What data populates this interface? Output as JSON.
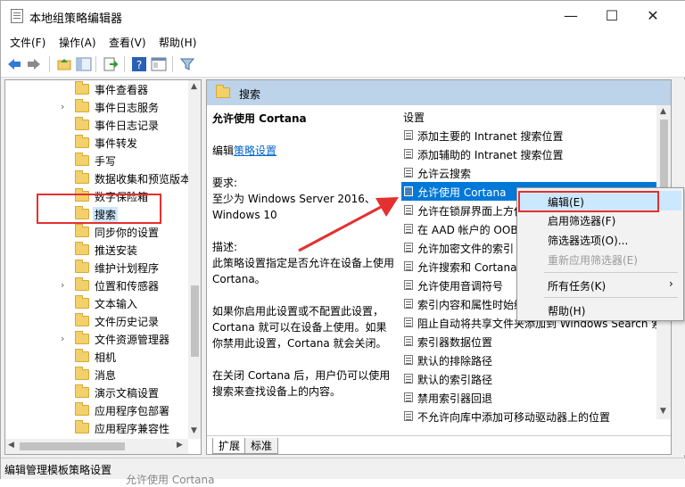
{
  "window": {
    "title": "本地组策略编辑器",
    "controls": {
      "minimize": "—",
      "maximize": "☐",
      "close": "✕"
    }
  },
  "menubar": [
    {
      "label": "文件(F)"
    },
    {
      "label": "操作(A)"
    },
    {
      "label": "查看(V)"
    },
    {
      "label": "帮助(H)"
    }
  ],
  "tree": {
    "items": [
      {
        "label": "事件查看器",
        "chevron": ""
      },
      {
        "label": "事件日志服务",
        "chevron": "›"
      },
      {
        "label": "事件日志记录",
        "chevron": ""
      },
      {
        "label": "事件转发",
        "chevron": ""
      },
      {
        "label": "手写",
        "chevron": ""
      },
      {
        "label": "数据收集和预览版本",
        "chevron": ""
      },
      {
        "label": "数字保险箱",
        "chevron": ""
      },
      {
        "label": "搜索",
        "chevron": ""
      },
      {
        "label": "同步你的设置",
        "chevron": ""
      },
      {
        "label": "推送安装",
        "chevron": ""
      },
      {
        "label": "维护计划程序",
        "chevron": ""
      },
      {
        "label": "位置和传感器",
        "chevron": "›"
      },
      {
        "label": "文本输入",
        "chevron": ""
      },
      {
        "label": "文件历史记录",
        "chevron": ""
      },
      {
        "label": "文件资源管理器",
        "chevron": "›"
      },
      {
        "label": "相机",
        "chevron": ""
      },
      {
        "label": "消息",
        "chevron": ""
      },
      {
        "label": "演示文稿设置",
        "chevron": ""
      },
      {
        "label": "应用程序包部署",
        "chevron": ""
      },
      {
        "label": "应用程序兼容性",
        "chevron": ""
      }
    ]
  },
  "right": {
    "header": "搜索",
    "description": {
      "title": "允许使用 Cortana",
      "edit_prefix": "编辑",
      "edit_link": "策略设置",
      "req_label": "要求:",
      "req_text": "至少为 Windows Server 2016、Windows 10",
      "desc_label": "描述:",
      "desc_text": "此策略设置指定是否允许在设备上使用 Cortana。",
      "p1": "如果你启用此设置或不配置此设置，Cortana 就可以在设备上使用。如果你禁用此设置，Cortana 就会关闭。",
      "p2": "在关闭 Cortana 后，用户仍可以使用搜索来查找设备上的内容。"
    },
    "list_header": "设置",
    "settings": [
      "添加主要的 Intranet 搜索位置",
      "添加辅助的 Intranet 搜索位置",
      "允许云搜索",
      "允许使用 Cortana",
      "允许在锁屏界面上方使用 Cortana",
      "在 AAD 帐户的 OOBE 期间允许 Cortana",
      "允许加密文件的索引",
      "允许搜索和 Cortana 使用位置",
      "允许使用音调符号",
      "索引内容和属性时始终使用自动语言检测",
      "阻止自动将共享文件夹添加到 Windows Search 索引",
      "索引器数据位置",
      "默认的排除路径",
      "默认的索引路径",
      "禁用索引器回退",
      "不允许向库中添加可移动驱动器上的位置"
    ],
    "tabs": [
      "扩展",
      "标准"
    ]
  },
  "context_menu": [
    {
      "label": "编辑(E)",
      "disabled": false,
      "submenu": ""
    },
    {
      "label": "启用筛选器(F)",
      "disabled": false,
      "submenu": ""
    },
    {
      "label": "筛选器选项(O)...",
      "disabled": false,
      "submenu": ""
    },
    {
      "label": "重新应用筛选器(E)",
      "disabled": true,
      "submenu": ""
    },
    {
      "label": "所有任务(K)",
      "disabled": false,
      "submenu": "›"
    },
    {
      "label": "帮助(H)",
      "disabled": false,
      "submenu": ""
    }
  ],
  "status": "编辑管理模板策略设置",
  "underneath_text": "允许使用 Cortana",
  "colors": {
    "selection": "#0078d7",
    "header_bg": "#bdd3ea",
    "annotation_red": "#e53030",
    "link": "#0066cc"
  }
}
